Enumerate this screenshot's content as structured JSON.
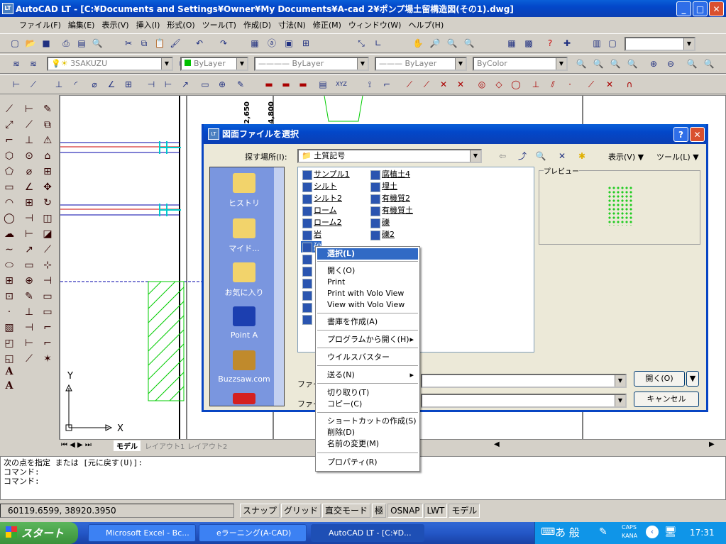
{
  "window": {
    "title": "AutoCAD LT - [C:¥Documents and Settings¥Owner¥My Documents¥A-cad 2¥ポンプ場土留構造図(その1).dwg]",
    "app_icon": "LT"
  },
  "menu": [
    "ファイル(F)",
    "編集(E)",
    "表示(V)",
    "挿入(I)",
    "形式(O)",
    "ツール(T)",
    "作成(D)",
    "寸法(N)",
    "修正(M)",
    "ウィンドウ(W)",
    "ヘルプ(H)"
  ],
  "layers": {
    "layer_name": "3SAKUZU",
    "color": "ByLayer",
    "linetype": "ByLayer",
    "lineweight": "ByLayer",
    "plotstyle": "ByColor"
  },
  "drawing": {
    "dim1": "2,650",
    "dim2": "14,800",
    "ucs_x": "X",
    "ucs_y": "Y"
  },
  "tabs": [
    "モデル",
    "レイアウト1",
    "レイアウト2"
  ],
  "command": {
    "lines": [
      "次の点を指定 または [元に戻す(U)]:",
      "コマンド:",
      "コマンド:"
    ]
  },
  "status": {
    "coords": "60119.6599, 38920.3950",
    "buttons": [
      "スナップ",
      "グリッド",
      "直交モード",
      "極",
      "OSNAP",
      "LWT",
      "モデル"
    ]
  },
  "dialog": {
    "title": "図面ファイルを選択",
    "look_in_label": "探す場所(I):",
    "look_in_value": "土質記号",
    "view_label": "表示(V)",
    "tools_label": "ツール(L)",
    "preview_label": "プレビュー",
    "places": [
      "ヒストリ",
      "マイド...",
      "お気に入り",
      "Point A",
      "Buzzsaw.com"
    ],
    "files_col1": [
      "サンプル1",
      "シルト",
      "シルト2",
      "ローム",
      "ローム2",
      "岩",
      "砂"
    ],
    "files_col2": [
      "腐植土4",
      "埋土",
      "有機質2",
      "有機質土",
      "礫",
      "礫2"
    ],
    "filename_label": "ファイル",
    "filetype_label": "ファイル",
    "open_button": "開く(O)",
    "cancel_button": "キャンセル"
  },
  "context_menu": {
    "items": [
      "選択(L)",
      "開く(O)",
      "Print",
      "Print with Volo View",
      "View with Volo View",
      "書庫を作成(A)",
      "プログラムから開く(H)",
      "ウイルスバスター",
      "送る(N)",
      "切り取り(T)",
      "コピー(C)",
      "ショートカットの作成(S)",
      "削除(D)",
      "名前の変更(M)",
      "プロパティ(R)"
    ]
  },
  "taskbar": {
    "start": "スタート",
    "items": [
      "Microsoft Excel - Bc...",
      "eラーニング(A-CAD)",
      "AutoCAD LT - [C:¥D..."
    ],
    "clock": "17:31",
    "ime": "あ 般",
    "caps": "CAPS",
    "kana": "KANA"
  },
  "colors": {
    "titlebar": "#0a5fd8",
    "places_bg": "#7a96df",
    "menu_highlight": "#316ac5"
  }
}
